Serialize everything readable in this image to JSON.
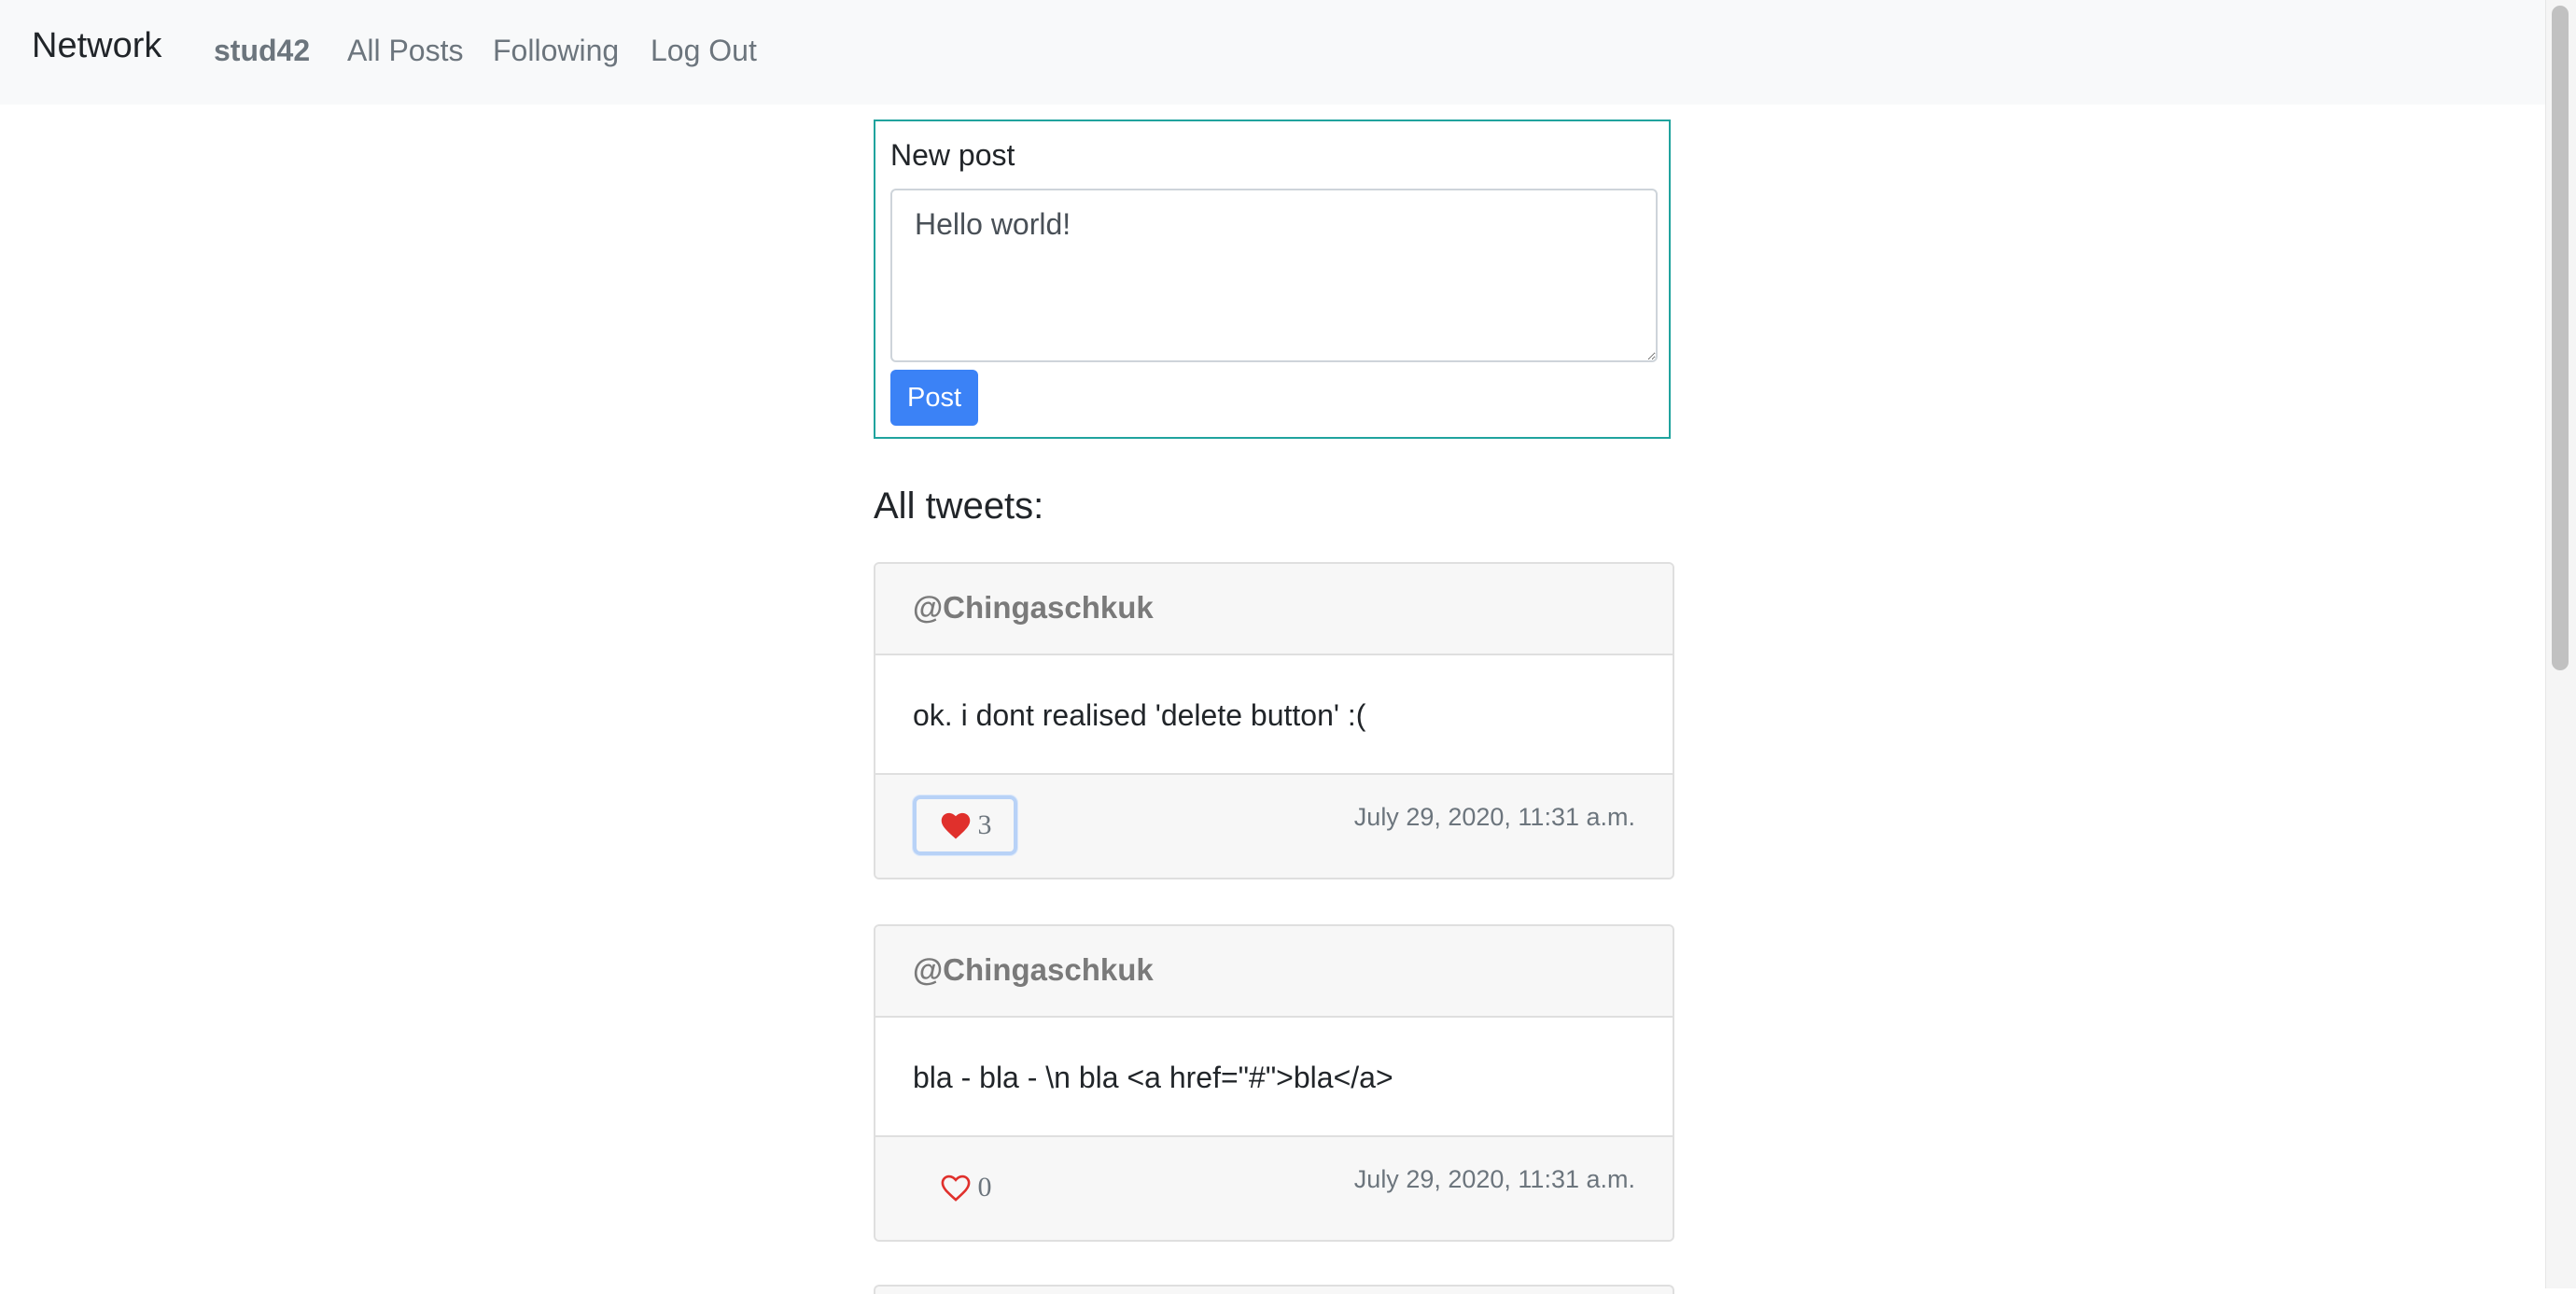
{
  "navbar": {
    "brand": "Network",
    "user": "stud42",
    "links": [
      "All Posts",
      "Following",
      "Log Out"
    ]
  },
  "new_post": {
    "label": "New post",
    "textarea_value": "Hello world!",
    "button_label": "Post"
  },
  "feed": {
    "title": "All tweets:",
    "tweets": [
      {
        "author": "@Chingaschkuk",
        "content": "ok. i dont realised 'delete button' :(",
        "likes": "3",
        "liked": true,
        "date": "July 29, 2020, 11:31 a.m."
      },
      {
        "author": "@Chingaschkuk",
        "content": "bla - bla - \\n bla <a href=\"#\">bla</a>",
        "likes": "0",
        "liked": false,
        "date": "July 29, 2020, 11:31 a.m."
      }
    ]
  },
  "colors": {
    "accent": "#3b82f6",
    "heart": "#e0302c",
    "new_post_border": "#20a39e"
  }
}
